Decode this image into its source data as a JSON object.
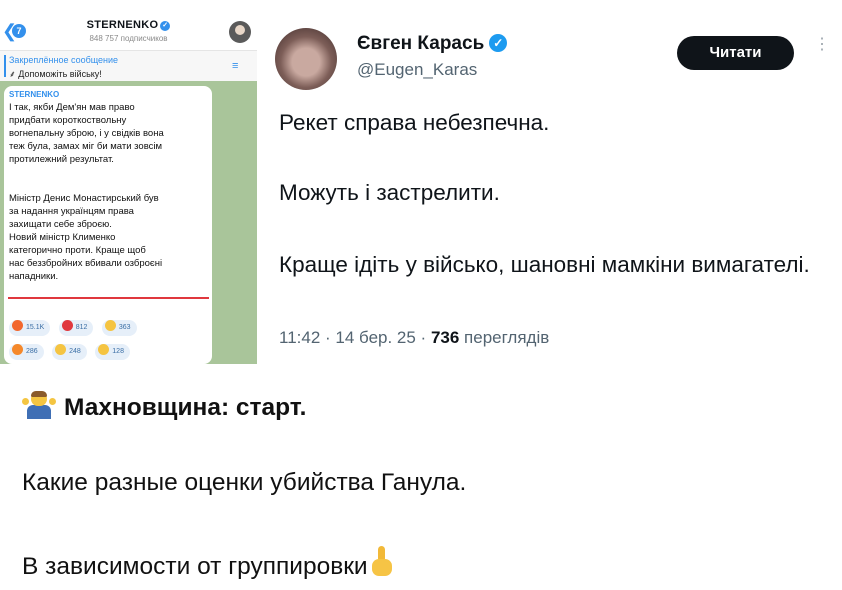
{
  "telegram": {
    "back_glyph": "❮",
    "badge": "7",
    "channel_name": "STERNENKO",
    "verified_glyph": "✓",
    "subscribers": "848 757 подписчиков",
    "pinned_title": "Закреплённое сообщение",
    "pinned_text": "⸙ Допоможіть війську!",
    "pinned_icon": "pinned-list-icon",
    "pinned_icon_glyph": "≡",
    "post_author": "STERNENKO",
    "post_paragraph_1": "І так, якби Дем'ян мав право\nпридбати короткоствольну\nвогнепальну зброю, і у свідків вона\nтеж була, замах міг би мати зовсім\nпротилежний результат.",
    "post_paragraph_2": "Міністр Денис Монастирський був\nза надання українцям права\nзахищати себе зброєю.\nНовий міністр Клименко\nкатегорично проти. Краще щоб\nнас беззбройних вбивали озброєні\nнападники.",
    "reactions_row_1": [
      {
        "icon": "angry-face-icon",
        "color": "#f2672e",
        "count": "15.1K"
      },
      {
        "icon": "heart-icon",
        "color": "#e0383e",
        "count": "812"
      },
      {
        "icon": "crying-face-icon",
        "color": "#f5c441",
        "count": "363"
      }
    ],
    "reactions_row_2": [
      {
        "icon": "fire-icon",
        "color": "#f5882a",
        "count": "286"
      },
      {
        "icon": "grinning-face-icon",
        "color": "#f5c441",
        "count": "248"
      },
      {
        "icon": "thinking-face-icon",
        "color": "#f5c441",
        "count": "128"
      }
    ]
  },
  "tweet": {
    "author_name": "Євген Карась",
    "verified_glyph": "✓",
    "handle": "@Eugen_Karas",
    "follow_label": "Читати",
    "more_glyph": "⋮",
    "line_1": "Рекет справа небезпечна.",
    "line_2": "Можуть і застрелити.",
    "line_3": "Краще ідіть у військо, шановні мамкіни вимагателі.",
    "timestamp": "11:42 · 14 бер. 25 · ",
    "views_count": "736",
    "views_label": " переглядів"
  },
  "post": {
    "headline_icon": "person-shrugging-icon",
    "headline": "Махновщина: старт.",
    "line_2": "Какие разные оценки убийства Ганула.",
    "line_3": "В зависимости от группировки",
    "line_3_icon": "pointing-up-icon"
  },
  "colors": {
    "telegram_accent": "#3390ec",
    "telegram_chat_bg": "#a9c59a",
    "twitter_blue": "#1d9bf0",
    "twitter_secondary": "#536471",
    "underline_red": "#e0383e"
  }
}
